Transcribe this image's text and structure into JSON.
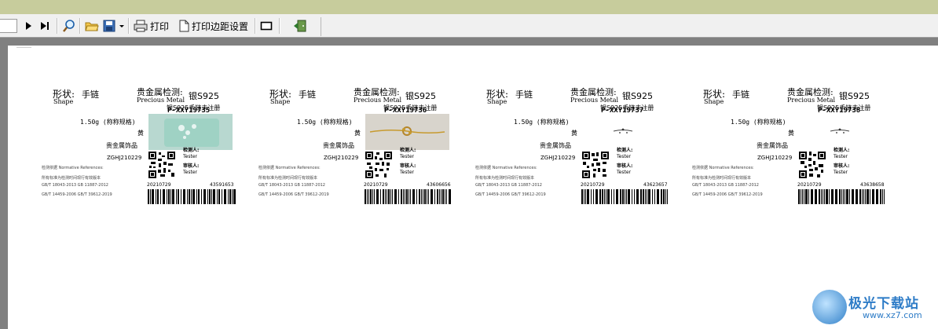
{
  "toolbar": {
    "print_label": "打印",
    "margin_label": "打印边距设置",
    "icons": [
      "next-page-icon",
      "last-page-icon",
      "zoom-icon",
      "open-folder-icon",
      "save-icon",
      "dropdown-arrow-icon",
      "printer-icon",
      "page-icon",
      "frame-icon",
      "exit-door-icon"
    ]
  },
  "labels": [
    {
      "shape_cn": "形状:",
      "shape_en": "Shape",
      "shape_value": "手链",
      "metal_cn": "贵金属检测:",
      "metal_en": "Precious Metal",
      "metal_value": "银S925",
      "name": "银S925手链未注册",
      "code": "P-XXY19735",
      "weight": "1.50g (称称规格)",
      "color": "黄",
      "category": "贵金属饰品",
      "id": "ZGHJ210229",
      "basis": "检测依据 Normative References:",
      "text": "所有标准为检测时间现行有效版本",
      "std1": "GB/T 18043-2013 GB 11887-2012",
      "std2": "GB/T 14459-2006 GB/T 39612-2019",
      "inspector": "检测人:",
      "tester": "Tester",
      "reviewer": "审核人:",
      "reviewer_en": "Tester",
      "date": "20210729",
      "serial": "43591653",
      "photo": "phone-case"
    },
    {
      "shape_cn": "形状:",
      "shape_en": "Shape",
      "shape_value": "手链",
      "metal_cn": "贵金属检测:",
      "metal_en": "Precious Metal",
      "metal_value": "银S925",
      "name": "银S925手链未注册",
      "code": "P-XXY19736",
      "weight": "1.50g (称称规格)",
      "color": "黄",
      "category": "贵金属饰品",
      "id": "ZGHJ210229",
      "basis": "检测依据 Normative References:",
      "text": "所有标准为检测时间现行有效版本",
      "std1": "GB/T 18043-2013 GB 11887-2012",
      "std2": "GB/T 14459-2006 GB/T 39612-2019",
      "inspector": "检测人:",
      "tester": "Tester",
      "reviewer": "审核人:",
      "reviewer_en": "Tester",
      "date": "20210729",
      "serial": "43606656",
      "photo": "bracelet"
    },
    {
      "shape_cn": "形状:",
      "shape_en": "Shape",
      "shape_value": "手链",
      "metal_cn": "贵金属检测:",
      "metal_en": "Precious Metal",
      "metal_value": "银S925",
      "name": "银S925手链未注册",
      "code": "P-XXY19737",
      "weight": "1.50g (称称规格)",
      "color": "黄",
      "category": "贵金属饰品",
      "id": "ZGHJ210229",
      "basis": "检测依据 Normative References:",
      "text": "所有标准为检测时间现行有效版本",
      "std1": "GB/T 18043-2013 GB 11887-2012",
      "std2": "GB/T 14459-2006 GB/T 39612-2019",
      "inspector": "检测人:",
      "tester": "Tester",
      "reviewer": "审核人:",
      "reviewer_en": "Tester",
      "date": "20210729",
      "serial": "43623657",
      "photo": "none"
    },
    {
      "shape_cn": "形状:",
      "shape_en": "Shape",
      "shape_value": "手链",
      "metal_cn": "贵金属检测:",
      "metal_en": "Precious Metal",
      "metal_value": "银S925",
      "name": "银S925手链未注册",
      "code": "P-XXY19738",
      "weight": "1.50g (称称规格)",
      "color": "黄",
      "category": "贵金属饰品",
      "id": "ZGHJ210229",
      "basis": "检测依据 Normative References:",
      "text": "所有标准为检测时间现行有效版本",
      "std1": "GB/T 18043-2013 GB 11887-2012",
      "std2": "GB/T 14459-2006 GB/T 39612-2019",
      "inspector": "检测人:",
      "tester": "Tester",
      "reviewer": "审核人:",
      "reviewer_en": "Tester",
      "date": "20210729",
      "serial": "43638658",
      "photo": "none"
    }
  ],
  "watermark": {
    "text": "极光下载站",
    "url": "www.xz7.com"
  },
  "colors": {
    "topstrip": "#c7cc9c",
    "background": "#808080",
    "toolbar": "#f0f0f0",
    "accent": "#2e7cc7"
  }
}
